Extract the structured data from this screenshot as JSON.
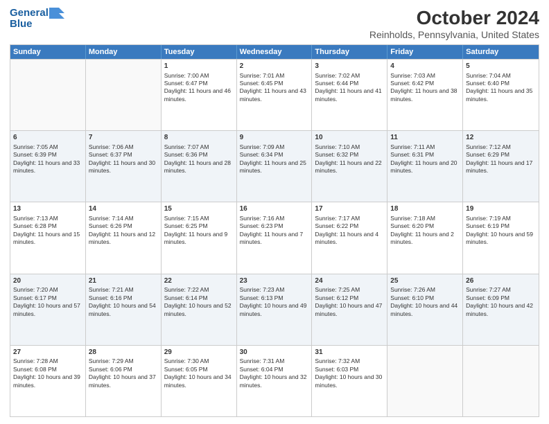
{
  "header": {
    "logo_line1": "General",
    "logo_line2": "Blue",
    "title": "October 2024",
    "subtitle": "Reinholds, Pennsylvania, United States"
  },
  "days_of_week": [
    "Sunday",
    "Monday",
    "Tuesday",
    "Wednesday",
    "Thursday",
    "Friday",
    "Saturday"
  ],
  "weeks": [
    [
      {
        "day": "",
        "content": ""
      },
      {
        "day": "",
        "content": ""
      },
      {
        "day": "1",
        "content": "Sunrise: 7:00 AM\nSunset: 6:47 PM\nDaylight: 11 hours and 46 minutes."
      },
      {
        "day": "2",
        "content": "Sunrise: 7:01 AM\nSunset: 6:45 PM\nDaylight: 11 hours and 43 minutes."
      },
      {
        "day": "3",
        "content": "Sunrise: 7:02 AM\nSunset: 6:44 PM\nDaylight: 11 hours and 41 minutes."
      },
      {
        "day": "4",
        "content": "Sunrise: 7:03 AM\nSunset: 6:42 PM\nDaylight: 11 hours and 38 minutes."
      },
      {
        "day": "5",
        "content": "Sunrise: 7:04 AM\nSunset: 6:40 PM\nDaylight: 11 hours and 35 minutes."
      }
    ],
    [
      {
        "day": "6",
        "content": "Sunrise: 7:05 AM\nSunset: 6:39 PM\nDaylight: 11 hours and 33 minutes."
      },
      {
        "day": "7",
        "content": "Sunrise: 7:06 AM\nSunset: 6:37 PM\nDaylight: 11 hours and 30 minutes."
      },
      {
        "day": "8",
        "content": "Sunrise: 7:07 AM\nSunset: 6:36 PM\nDaylight: 11 hours and 28 minutes."
      },
      {
        "day": "9",
        "content": "Sunrise: 7:09 AM\nSunset: 6:34 PM\nDaylight: 11 hours and 25 minutes."
      },
      {
        "day": "10",
        "content": "Sunrise: 7:10 AM\nSunset: 6:32 PM\nDaylight: 11 hours and 22 minutes."
      },
      {
        "day": "11",
        "content": "Sunrise: 7:11 AM\nSunset: 6:31 PM\nDaylight: 11 hours and 20 minutes."
      },
      {
        "day": "12",
        "content": "Sunrise: 7:12 AM\nSunset: 6:29 PM\nDaylight: 11 hours and 17 minutes."
      }
    ],
    [
      {
        "day": "13",
        "content": "Sunrise: 7:13 AM\nSunset: 6:28 PM\nDaylight: 11 hours and 15 minutes."
      },
      {
        "day": "14",
        "content": "Sunrise: 7:14 AM\nSunset: 6:26 PM\nDaylight: 11 hours and 12 minutes."
      },
      {
        "day": "15",
        "content": "Sunrise: 7:15 AM\nSunset: 6:25 PM\nDaylight: 11 hours and 9 minutes."
      },
      {
        "day": "16",
        "content": "Sunrise: 7:16 AM\nSunset: 6:23 PM\nDaylight: 11 hours and 7 minutes."
      },
      {
        "day": "17",
        "content": "Sunrise: 7:17 AM\nSunset: 6:22 PM\nDaylight: 11 hours and 4 minutes."
      },
      {
        "day": "18",
        "content": "Sunrise: 7:18 AM\nSunset: 6:20 PM\nDaylight: 11 hours and 2 minutes."
      },
      {
        "day": "19",
        "content": "Sunrise: 7:19 AM\nSunset: 6:19 PM\nDaylight: 10 hours and 59 minutes."
      }
    ],
    [
      {
        "day": "20",
        "content": "Sunrise: 7:20 AM\nSunset: 6:17 PM\nDaylight: 10 hours and 57 minutes."
      },
      {
        "day": "21",
        "content": "Sunrise: 7:21 AM\nSunset: 6:16 PM\nDaylight: 10 hours and 54 minutes."
      },
      {
        "day": "22",
        "content": "Sunrise: 7:22 AM\nSunset: 6:14 PM\nDaylight: 10 hours and 52 minutes."
      },
      {
        "day": "23",
        "content": "Sunrise: 7:23 AM\nSunset: 6:13 PM\nDaylight: 10 hours and 49 minutes."
      },
      {
        "day": "24",
        "content": "Sunrise: 7:25 AM\nSunset: 6:12 PM\nDaylight: 10 hours and 47 minutes."
      },
      {
        "day": "25",
        "content": "Sunrise: 7:26 AM\nSunset: 6:10 PM\nDaylight: 10 hours and 44 minutes."
      },
      {
        "day": "26",
        "content": "Sunrise: 7:27 AM\nSunset: 6:09 PM\nDaylight: 10 hours and 42 minutes."
      }
    ],
    [
      {
        "day": "27",
        "content": "Sunrise: 7:28 AM\nSunset: 6:08 PM\nDaylight: 10 hours and 39 minutes."
      },
      {
        "day": "28",
        "content": "Sunrise: 7:29 AM\nSunset: 6:06 PM\nDaylight: 10 hours and 37 minutes."
      },
      {
        "day": "29",
        "content": "Sunrise: 7:30 AM\nSunset: 6:05 PM\nDaylight: 10 hours and 34 minutes."
      },
      {
        "day": "30",
        "content": "Sunrise: 7:31 AM\nSunset: 6:04 PM\nDaylight: 10 hours and 32 minutes."
      },
      {
        "day": "31",
        "content": "Sunrise: 7:32 AM\nSunset: 6:03 PM\nDaylight: 10 hours and 30 minutes."
      },
      {
        "day": "",
        "content": ""
      },
      {
        "day": "",
        "content": ""
      }
    ]
  ]
}
